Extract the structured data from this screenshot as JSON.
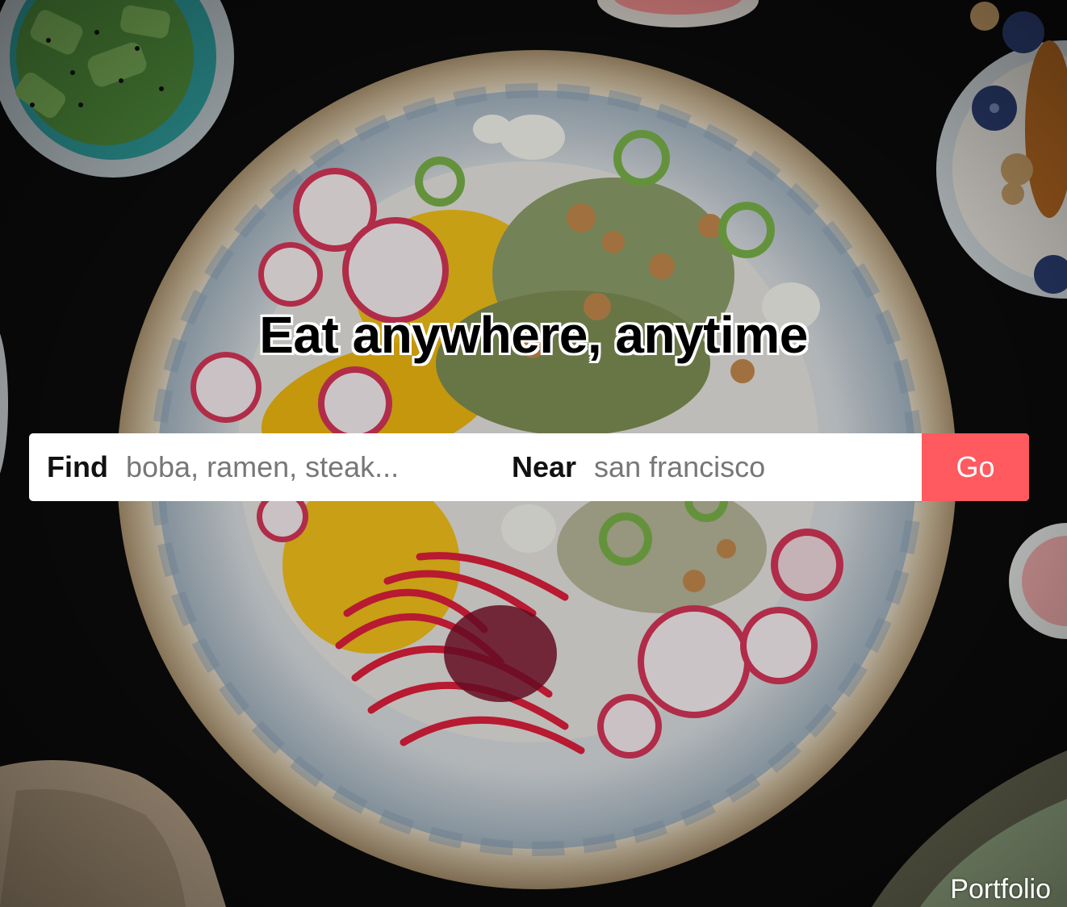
{
  "hero": {
    "headline": "Eat anywhere, anytime",
    "background_image": "poke-bowl-food-photo"
  },
  "search": {
    "find_label": "Find",
    "find_placeholder": "boba, ramen, steak...",
    "near_label": "Near",
    "near_placeholder": "san francisco",
    "go_label": "Go"
  },
  "footer": {
    "portfolio_link": "Portfolio"
  },
  "colors": {
    "accent": "#ff5a5f",
    "background": "#0b0b0c",
    "search_bg": "#ffffff"
  }
}
